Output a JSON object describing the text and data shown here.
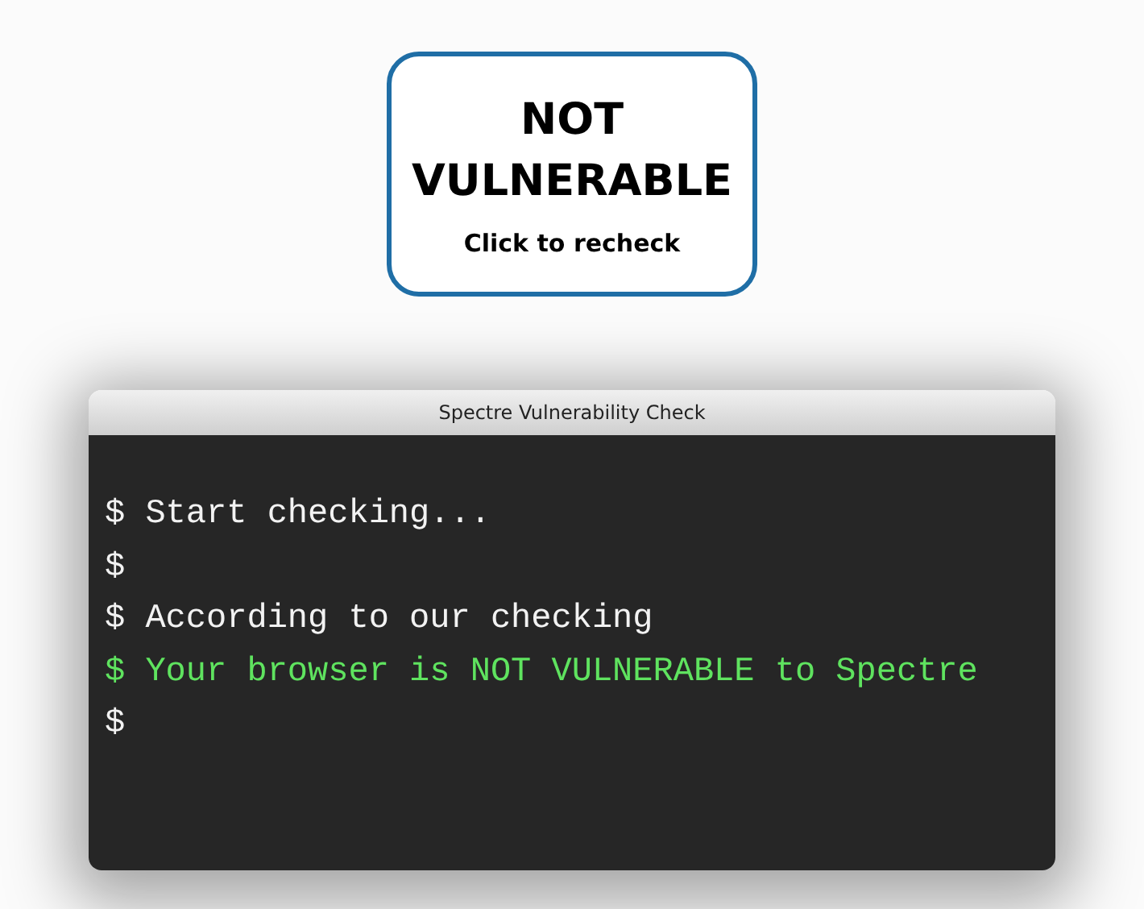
{
  "check_button": {
    "status": "NOT VULNERABLE",
    "action": "Click to recheck"
  },
  "terminal": {
    "title": "Spectre Vulnerability Check",
    "lines": [
      {
        "text": "$ Start checking...",
        "color": "#f2f2f2"
      },
      {
        "text": "$",
        "color": "#f2f2f2"
      },
      {
        "text": "$ According to our checking",
        "color": "#f2f2f2"
      },
      {
        "text": "$ Your browser is NOT VULNERABLE to Spectre",
        "color": "#5fe35f"
      },
      {
        "text": "$",
        "color": "#f2f2f2"
      }
    ]
  }
}
